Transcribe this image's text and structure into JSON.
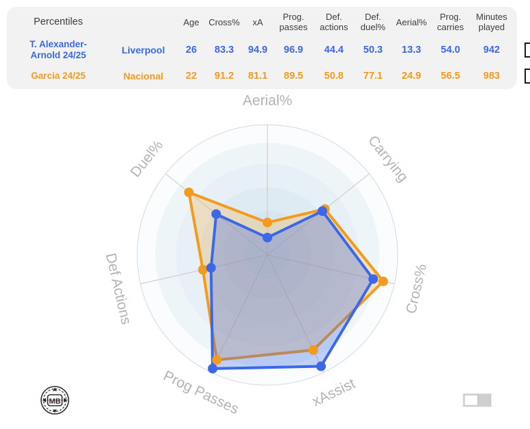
{
  "table": {
    "title": "Percentiles",
    "columns": [
      "Age",
      "Cross%",
      "xA",
      "Prog. passes",
      "Def. actions",
      "Def. duel%",
      "Aerial%",
      "Prog. carries",
      "Minutes played"
    ],
    "columns_wrapped": [
      {
        "l1": "Age",
        "l2": ""
      },
      {
        "l1": "Cross%",
        "l2": ""
      },
      {
        "l1": "xA",
        "l2": ""
      },
      {
        "l1": "Prog.",
        "l2": "passes"
      },
      {
        "l1": "Def.",
        "l2": "actions"
      },
      {
        "l1": "Def.",
        "l2": "duel%"
      },
      {
        "l1": "Aerial%",
        "l2": ""
      },
      {
        "l1": "Prog.",
        "l2": "carries"
      },
      {
        "l1": "Minutes",
        "l2": "played"
      }
    ],
    "rows": [
      {
        "name_line1": "T. Alexander-",
        "name_line2": "Arnold 24/25",
        "team": "Liverpool",
        "color": "#3b68e8",
        "age": "26",
        "cross_pct": "83.3",
        "xa": "94.9",
        "prog_passes": "96.9",
        "def_actions": "44.4",
        "def_duel_pct": "50.3",
        "aerial_pct": "13.3",
        "prog_carries": "54.0",
        "minutes_played": "942",
        "remove_label": "x"
      },
      {
        "name_line1": "Garcia 24/25",
        "name_line2": "",
        "team": "Nacional",
        "color": "#f49a1c",
        "age": "22",
        "cross_pct": "91.2",
        "xa": "81.1",
        "prog_passes": "89.5",
        "def_actions": "50.8",
        "def_duel_pct": "77.1",
        "aerial_pct": "24.9",
        "prog_carries": "56.5",
        "minutes_played": "983",
        "remove_label": "x"
      }
    ]
  },
  "chart_data": {
    "type": "radar",
    "title": "",
    "categories": [
      "Aerial%",
      "Carrying",
      "Cross%",
      "xAssist",
      "Prog Passes",
      "Def Actions",
      "Duel%"
    ],
    "rlim": [
      0,
      100
    ],
    "grid": true,
    "legend": "none",
    "series": [
      {
        "name": "T. Alexander-Arnold 24/25",
        "color": "#3b68e8",
        "fill": "#3b68e8",
        "values": [
          13.3,
          54.0,
          83.3,
          94.9,
          96.9,
          44.4,
          50.3
        ]
      },
      {
        "name": "Garcia 24/25",
        "color": "#f49a1c",
        "fill": "#f4b24c",
        "values": [
          24.9,
          56.5,
          91.2,
          81.1,
          89.5,
          50.8,
          77.1
        ]
      }
    ]
  },
  "footer": {
    "logo_text": "MB",
    "toggle_state": "off"
  },
  "colors": {
    "blue": "#3b68e8",
    "orange": "#f49a1c",
    "panel_bg": "#f2f2f2",
    "axis_label": "#b3b3b3"
  }
}
